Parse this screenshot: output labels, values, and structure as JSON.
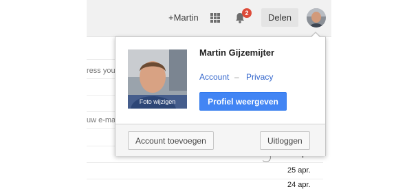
{
  "header": {
    "plus_user": "+Martin",
    "notification_count": "2",
    "share_label": "Delen",
    "icons": [
      "apps-grid-icon",
      "bell-icon",
      "avatar"
    ]
  },
  "background_list": {
    "fragments": [
      "ress you",
      "uw e-ma"
    ],
    "dates": [
      "25 apr.",
      "25 apr.",
      "24 apr."
    ]
  },
  "account_popup": {
    "photo_caption": "Foto wijzigen",
    "user_name": "Martin Gijzemijter",
    "account_link": "Account",
    "separator": "–",
    "privacy_link": "Privacy",
    "profile_button": "Profiel weergeven",
    "add_account_button": "Account toevoegen",
    "logout_button": "Uitloggen"
  },
  "colors": {
    "primary_button": "#4285f4",
    "link": "#3366cc",
    "badge": "#dd4b39",
    "topbar": "#f1f1f1"
  }
}
